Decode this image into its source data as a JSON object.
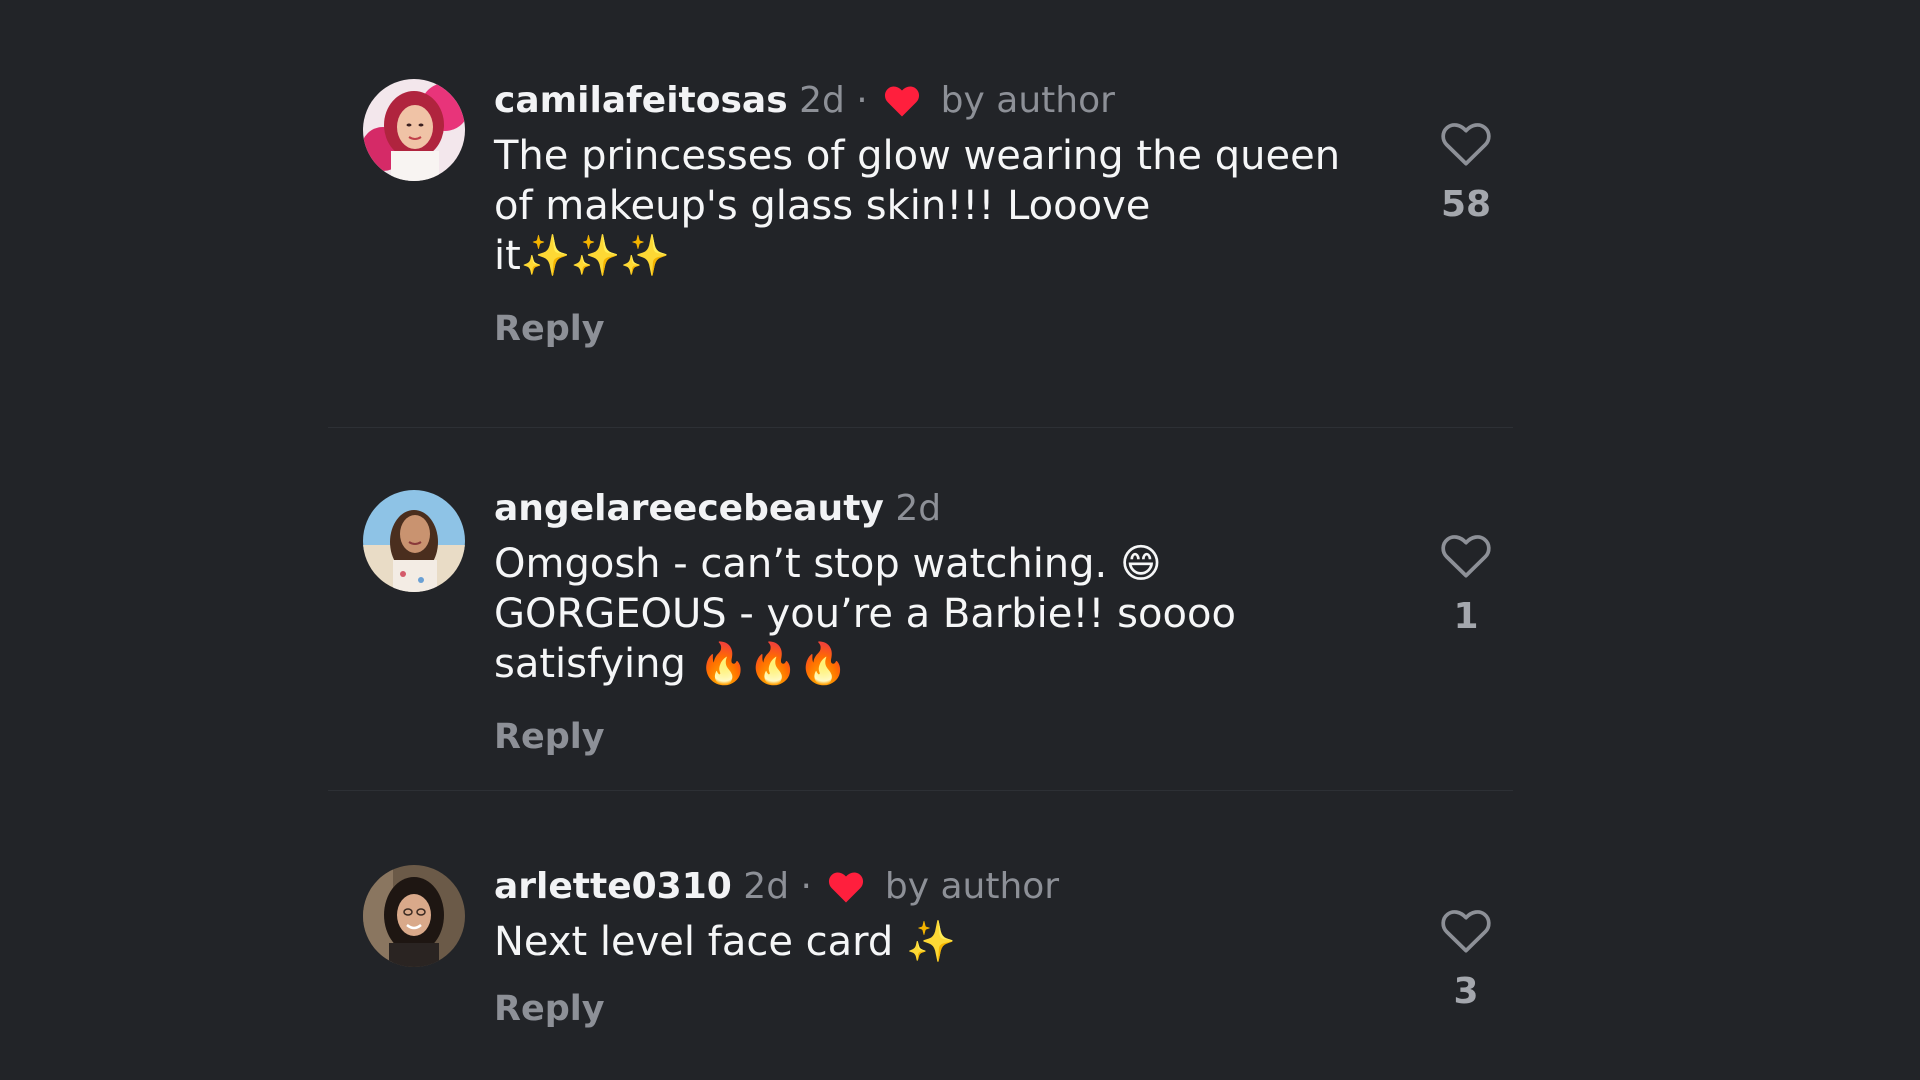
{
  "colors": {
    "background": "#222428",
    "divider": "#2d3035",
    "username": "#f2f3f5",
    "muted": "#8d9097",
    "text": "#f5f6f7",
    "author_heart": "#ff1f3d"
  },
  "comments": [
    {
      "username": "camilafeitosas",
      "time": "2d",
      "separator": "·",
      "author_liked": true,
      "author_label": "by author",
      "text": "The princesses of glow wearing the queen\nof makeup's glass skin!!! Looove\nit✨✨✨",
      "reply_label": "Reply",
      "like_count": "58",
      "like_icon": "heart-outline-icon",
      "avatar_icon": "avatar-pink-hair"
    },
    {
      "username": "angelareecebeauty",
      "time": "2d",
      "separator": "",
      "author_liked": false,
      "author_label": "",
      "text": "Omgosh -  can’t stop watching. 😄\nGORGEOUS - you’re a Barbie!! soooo\nsatisfying 🔥🔥🔥",
      "reply_label": "Reply",
      "like_count": "1",
      "like_icon": "heart-outline-icon",
      "avatar_icon": "avatar-beach"
    },
    {
      "username": "arlette0310",
      "time": "2d",
      "separator": "·",
      "author_liked": true,
      "author_label": "by author",
      "text": "Next level face card ✨",
      "reply_label": "Reply",
      "like_count": "3",
      "like_icon": "heart-outline-icon",
      "avatar_icon": "avatar-dark-hair"
    }
  ]
}
